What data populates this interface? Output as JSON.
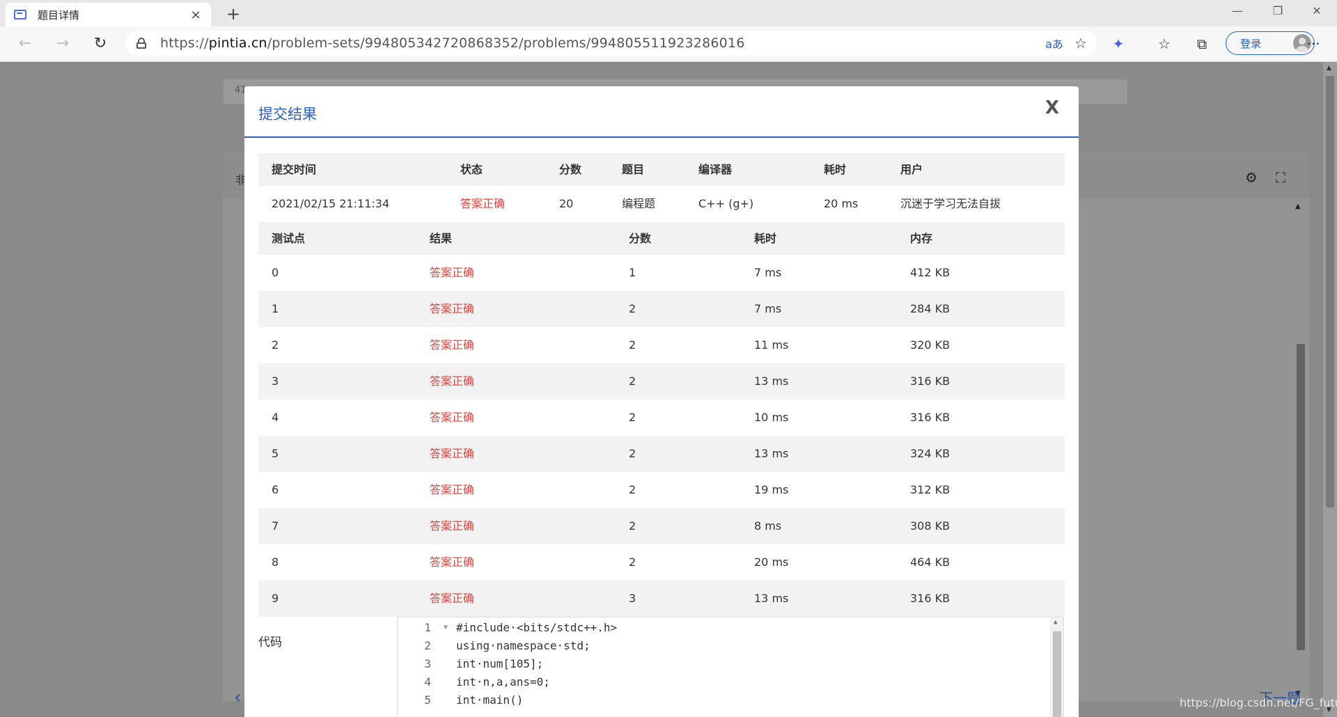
{
  "browser": {
    "tab_title": "题目详情",
    "tab_close": "×",
    "new_tab": "+",
    "url_scheme": "https://",
    "url_host": "pintia.cn",
    "url_path": "/problem-sets/994805342720868352/problems/994805511923286016",
    "translate_icon": "aあ",
    "login_label": "登录",
    "more": "···",
    "min": "—",
    "max": "❐",
    "close": "✕"
  },
  "background": {
    "search_text": "41",
    "panel_label": "非",
    "next_label": "下一题"
  },
  "modal": {
    "title": "提交结果",
    "close_label": "X",
    "summary_headers": [
      "提交时间",
      "状态",
      "分数",
      "题目",
      "编译器",
      "耗时",
      "用户"
    ],
    "summary": {
      "time": "2021/02/15 21:11:34",
      "status": "答案正确",
      "score": "20",
      "problem": "编程题",
      "compiler": "C++ (g+)",
      "elapsed": "20 ms",
      "user": "沉迷于学习无法自拔"
    },
    "case_headers": [
      "测试点",
      "结果",
      "分数",
      "耗时",
      "内存"
    ],
    "cases": [
      {
        "id": "0",
        "result": "答案正确",
        "score": "1",
        "time": "7 ms",
        "memory": "412 KB"
      },
      {
        "id": "1",
        "result": "答案正确",
        "score": "2",
        "time": "7 ms",
        "memory": "284 KB"
      },
      {
        "id": "2",
        "result": "答案正确",
        "score": "2",
        "time": "11 ms",
        "memory": "320 KB"
      },
      {
        "id": "3",
        "result": "答案正确",
        "score": "2",
        "time": "13 ms",
        "memory": "316 KB"
      },
      {
        "id": "4",
        "result": "答案正确",
        "score": "2",
        "time": "10 ms",
        "memory": "316 KB"
      },
      {
        "id": "5",
        "result": "答案正确",
        "score": "2",
        "time": "13 ms",
        "memory": "324 KB"
      },
      {
        "id": "6",
        "result": "答案正确",
        "score": "2",
        "time": "19 ms",
        "memory": "312 KB"
      },
      {
        "id": "7",
        "result": "答案正确",
        "score": "2",
        "time": "8 ms",
        "memory": "308 KB"
      },
      {
        "id": "8",
        "result": "答案正确",
        "score": "2",
        "time": "20 ms",
        "memory": "464 KB"
      },
      {
        "id": "9",
        "result": "答案正确",
        "score": "3",
        "time": "13 ms",
        "memory": "316 KB"
      }
    ],
    "code_label": "代码",
    "code_lines": [
      {
        "n": "1",
        "text": "#include·<bits/stdc++.h>"
      },
      {
        "n": "2",
        "text": "using·namespace·std;"
      },
      {
        "n": "3",
        "text": "int·num[105];"
      },
      {
        "n": "4",
        "text": "int·n,a,ans=0;"
      },
      {
        "n": "5",
        "text": "int·main()"
      }
    ]
  },
  "watermark": "https://blog.csdn.net/FG_future"
}
